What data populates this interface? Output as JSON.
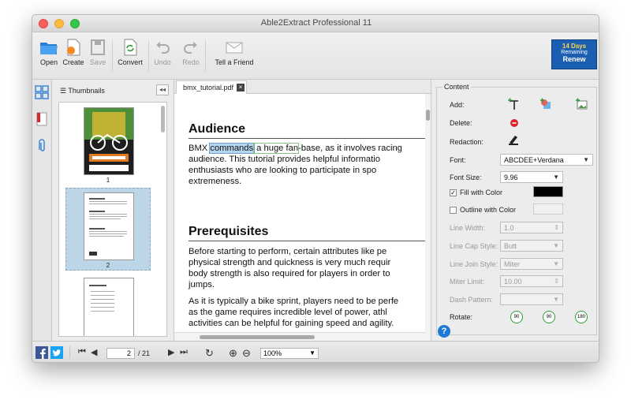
{
  "window": {
    "title": "Able2Extract Professional 11"
  },
  "toolbar": {
    "open": "Open",
    "create": "Create",
    "save": "Save",
    "convert": "Convert",
    "undo": "Undo",
    "redo": "Redo",
    "tell_friend": "Tell a Friend"
  },
  "trial": {
    "days": "14 Days",
    "remaining": "Remaining",
    "renew": "Renew"
  },
  "thumbnails": {
    "header": "Thumbnails",
    "pages": [
      "1",
      "2"
    ]
  },
  "document": {
    "tab_label": "bmx_tutorial.pdf",
    "heading1": "Audience",
    "p1_pre": "BMX ",
    "p1_sel": "commands",
    "p1_mid": " a huge fan",
    "p1_post": "-base, as it involves racing",
    "p1_l2": "audience. This tutorial provides helpful informatio",
    "p1_l3": "enthusiasts who are looking to participate in spo",
    "p1_l4": "extremeness.",
    "heading2": "Prerequisites",
    "p2_l1": "Before starting to perform, certain attributes like pe",
    "p2_l2": "physical strength and quickness is very much requir",
    "p2_l3": "body strength is also required for players in order to",
    "p2_l4": "jumps.",
    "p3_l1": "As it is typically a bike sprint, players need to be perfe",
    "p3_l2": "as the game requires incredible level of power, athl",
    "p3_l3": "activities can be helpful for gaining speed and agility."
  },
  "content_panel": {
    "title": "Content",
    "add": "Add:",
    "delete": "Delete:",
    "redaction": "Redaction:",
    "font_label": "Font:",
    "font_value": "ABCDEE+Verdana",
    "font_size_label": "Font Size:",
    "font_size_value": "9.96",
    "fill_color": "Fill with Color",
    "fill_checked": "✓",
    "fill_color_value": "#000000",
    "outline_color": "Outline with Color",
    "line_width_label": "Line Width:",
    "line_width_value": "1.0",
    "line_cap_label": "Line Cap Style:",
    "line_cap_value": "Butt",
    "line_join_label": "Line Join Style:",
    "line_join_value": "Miter",
    "miter_limit_label": "Miter Limit:",
    "miter_limit_value": "10.00",
    "dash_pattern_label": "Dash Pattern:",
    "rotate_label": "Rotate:",
    "rotate_values": [
      "90",
      "90",
      "180"
    ]
  },
  "bottom": {
    "page_current": "2",
    "page_total": "/ 21",
    "zoom": "100%"
  },
  "colors": {
    "accent": "#1b5fb3",
    "facebook": "#3b5998",
    "twitter": "#1da1f2",
    "selection": "#bcd6e8"
  }
}
